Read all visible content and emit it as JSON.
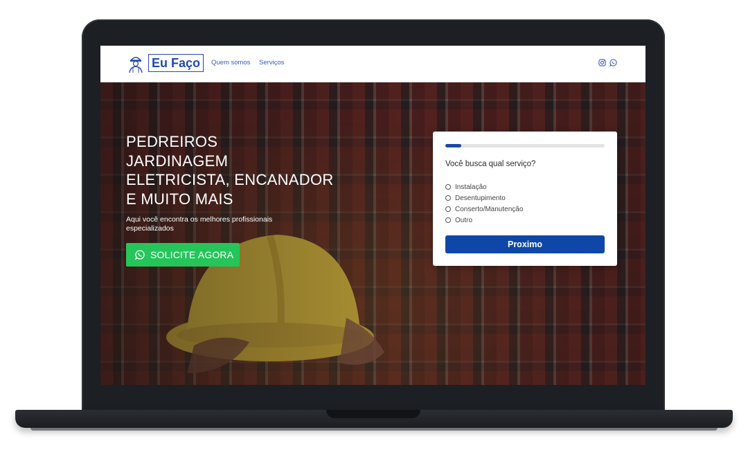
{
  "navbar": {
    "logo_text": "Eu Faço",
    "links": [
      "Quem somos",
      "Serviços"
    ],
    "social_icons": [
      "instagram-icon",
      "whatsapp-icon"
    ]
  },
  "hero": {
    "title_lines": [
      "PEDREIROS",
      "JARDINAGEM",
      "ELETRICISTA, ENCANADOR",
      "E MUITO MAIS"
    ],
    "subtitle": "Aqui você encontra os melhores profissionais especializados",
    "cta_label": "SOLICITE AGORA",
    "cta_color": "#25c55a"
  },
  "form": {
    "progress": 0.1,
    "question": "Você busca qual serviço?",
    "options": [
      "Instalação",
      "Desentupimento",
      "Conserto/Manutenção",
      "Outro"
    ],
    "next_label": "Proximo",
    "accent_color": "#0e47a8"
  }
}
